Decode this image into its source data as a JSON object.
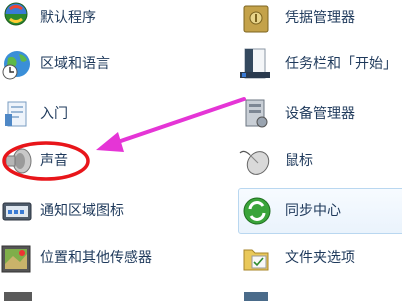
{
  "left_column": [
    {
      "label": "默认程序",
      "icon": "default-programs-icon"
    },
    {
      "label": "区域和语言",
      "icon": "region-language-icon"
    },
    {
      "label": "入门",
      "icon": "getting-started-icon"
    },
    {
      "label": "声音",
      "icon": "sound-icon"
    },
    {
      "label": "通知区域图标",
      "icon": "notification-area-icon"
    },
    {
      "label": "位置和其他传感器",
      "icon": "location-sensors-icon"
    }
  ],
  "right_column": [
    {
      "label": "凭据管理器",
      "icon": "credential-manager-icon"
    },
    {
      "label": "任务栏和「开始」",
      "icon": "taskbar-start-icon"
    },
    {
      "label": "设备管理器",
      "icon": "device-manager-icon"
    },
    {
      "label": "鼠标",
      "icon": "mouse-icon"
    },
    {
      "label": "同步中心",
      "icon": "sync-center-icon"
    },
    {
      "label": "文件夹选项",
      "icon": "folder-options-icon"
    }
  ],
  "annotation": {
    "highlight_color": "#e8151a",
    "arrow_color": "#e535d6",
    "highlighted_item": "声音"
  }
}
